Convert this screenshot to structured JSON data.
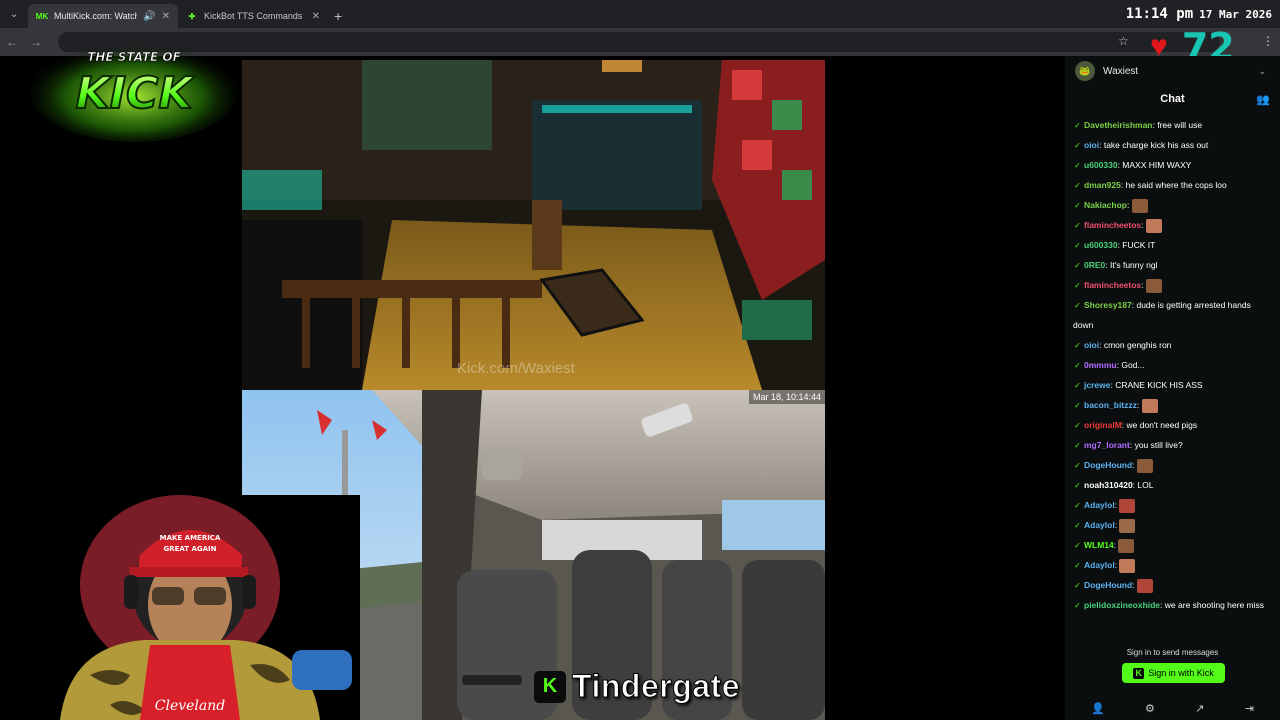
{
  "browser": {
    "tabs": [
      {
        "label": "MultiKick.com: Watch Multi",
        "icon": "MK",
        "active": true
      },
      {
        "label": "KickBot TTS Commands",
        "icon": "kickbot-icon",
        "active": false
      }
    ],
    "new_tab": "+"
  },
  "overlay": {
    "time": "11:14 pm",
    "date": "17 Mar 2026",
    "heart_rate": "72",
    "logo_line1": "THE STATE OF",
    "logo_line2": "KICK",
    "caption_icon": "K",
    "caption": "Tindergate"
  },
  "videos": {
    "top_watermark": "Kick.com/Waxiest",
    "bottom_timestamp": "Mar 18, 10:14:44"
  },
  "chat": {
    "channel": "Waxiest",
    "tab_label": "Chat",
    "messages": [
      {
        "user": "Davetheirishman",
        "text": "free will use",
        "color": "#7bd148"
      },
      {
        "user": "oioi",
        "text": "take charge kick his ass out",
        "color": "#5ab3f0"
      },
      {
        "user": "u600330",
        "text": "MAXX HIM WAXY",
        "color": "#4ad17b"
      },
      {
        "user": "dman925",
        "text": "he said where the cops loo",
        "color": "#7bd148"
      },
      {
        "user": "Nakiachop",
        "text": "",
        "color": "#7bd148"
      },
      {
        "user": "flamincheetos",
        "text": "",
        "color": "#f0506e"
      },
      {
        "user": "u600330",
        "text": "FUCK IT",
        "color": "#4ad17b"
      },
      {
        "user": "0RE0",
        "text": "It's funny ngl",
        "color": "#4ad17b"
      },
      {
        "user": "flamincheetos",
        "text": "",
        "color": "#f0506e"
      },
      {
        "user": "Shoresy187",
        "text": "dude is getting arrested hands down",
        "color": "#7bd148"
      },
      {
        "user": "oioi",
        "text": "cmon genghis ron",
        "color": "#5ab3f0"
      },
      {
        "user": "0mmmu",
        "text": "God...",
        "color": "#b36bff"
      },
      {
        "user": "jcrewe",
        "text": "CRANE KICK HIS ASS",
        "color": "#5ab3f0"
      },
      {
        "user": "bacon_bitzzz",
        "text": "",
        "color": "#5ab3f0"
      },
      {
        "user": "originalM",
        "text": "we don't need pigs",
        "color": "#f03a3a"
      },
      {
        "user": "mg7_lorant",
        "text": "you still live?",
        "color": "#b36bff"
      },
      {
        "user": "DogeHound",
        "text": "",
        "color": "#5ab3f0"
      },
      {
        "user": "noah310420",
        "text": "LOL",
        "color": "#ffffff"
      },
      {
        "user": "Adaylol",
        "text": "",
        "color": "#5ab3f0"
      },
      {
        "user": "Adaylol",
        "text": "",
        "color": "#5ab3f0"
      },
      {
        "user": "WLM14",
        "text": "",
        "color": "#53fc18"
      },
      {
        "user": "Adaylol",
        "text": "",
        "color": "#5ab3f0"
      },
      {
        "user": "DogeHound",
        "text": "",
        "color": "#5ab3f0"
      },
      {
        "user": "pielidoxzineoxhide",
        "text": "we are shooting here miss",
        "color": "#4ad17b"
      }
    ],
    "signin_prompt": "Sign in to send messages",
    "signin_button": "Sign in with Kick",
    "accent": "#53fc18"
  }
}
